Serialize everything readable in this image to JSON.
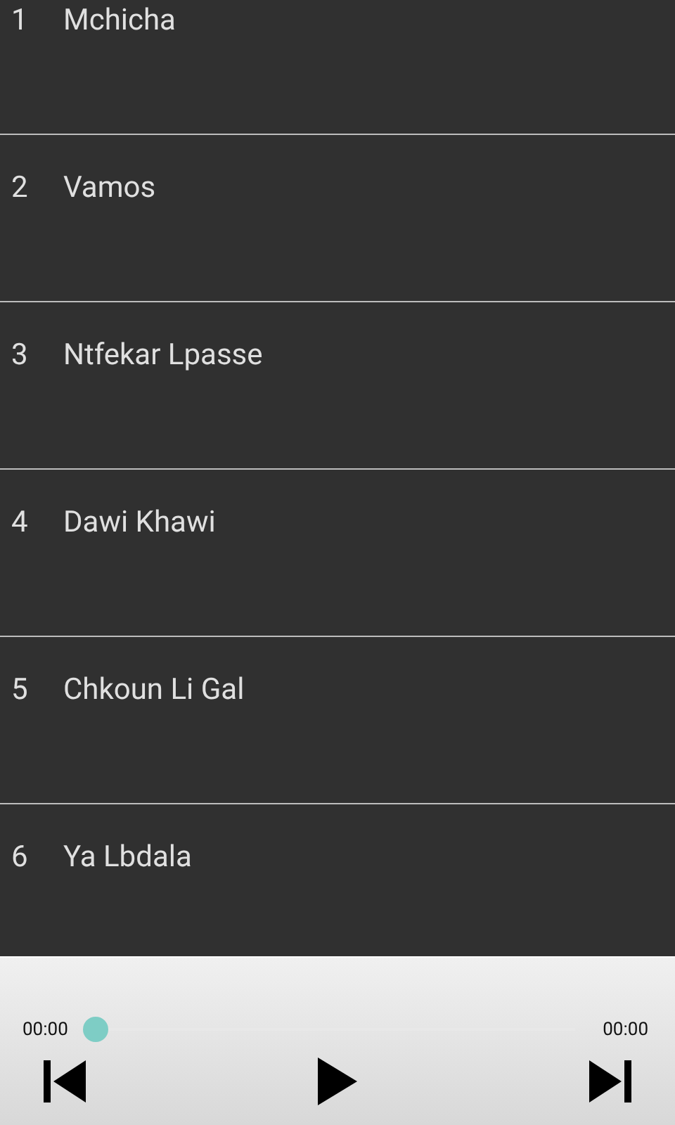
{
  "tracks": [
    {
      "number": "1",
      "title": "Mchicha"
    },
    {
      "number": "2",
      "title": "Vamos"
    },
    {
      "number": "3",
      "title": "Ntfekar Lpasse"
    },
    {
      "number": "4",
      "title": "Dawi Khawi"
    },
    {
      "number": "5",
      "title": "Chkoun Li Gal"
    },
    {
      "number": "6",
      "title": "Ya Lbdala"
    }
  ],
  "player": {
    "elapsed": "00:00",
    "duration": "00:00",
    "level": 0
  }
}
